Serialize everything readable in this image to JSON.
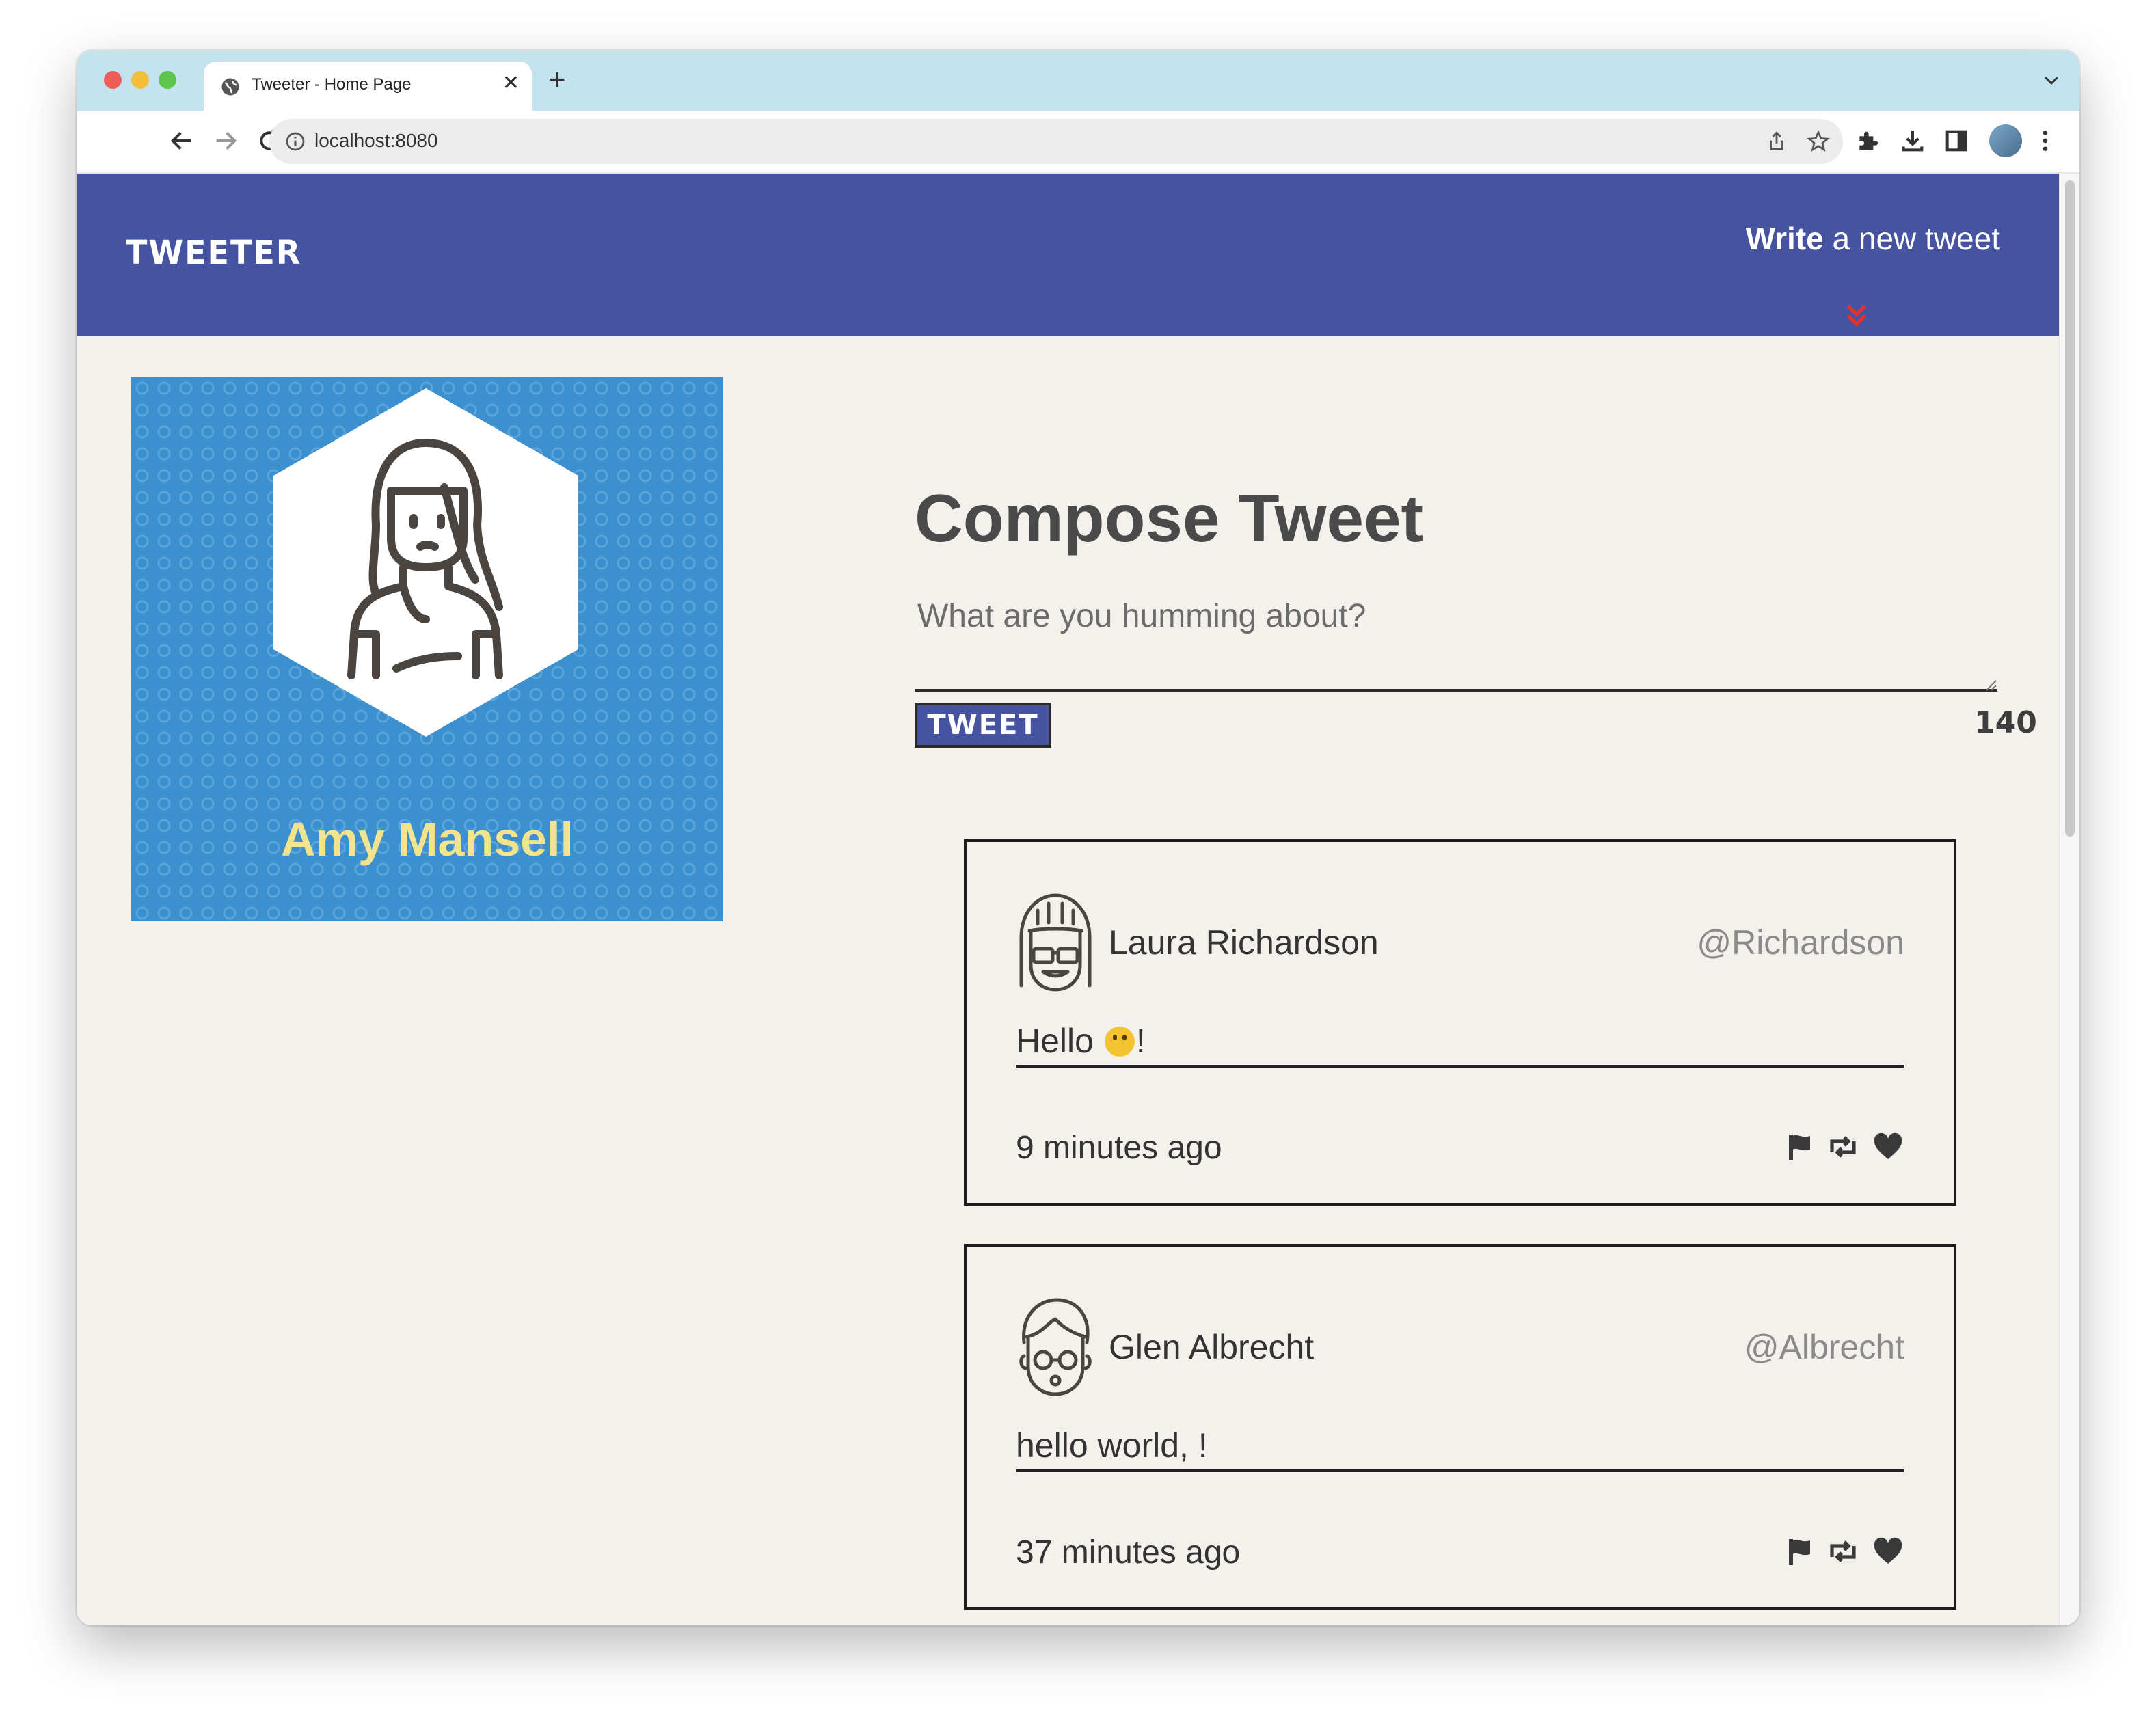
{
  "browser": {
    "tab_title": "Tweeter - Home Page",
    "url": "localhost:8080"
  },
  "app": {
    "brand": "TWEETER",
    "write_bold": "Write",
    "write_rest": " a new tweet"
  },
  "profile": {
    "name": "Amy Mansell"
  },
  "compose": {
    "title": "Compose Tweet",
    "placeholder": "What are you humming about?",
    "button": "TWEET",
    "counter": "140"
  },
  "tweets": [
    {
      "name": "Laura Richardson",
      "handle": "@Richardson",
      "content_before": "Hello ",
      "content_emoji": "grinning-face",
      "content_after": "!",
      "time": "9 minutes ago"
    },
    {
      "name": "Glen Albrecht",
      "handle": "@Albrecht",
      "content": "hello world, !",
      "time": "37 minutes ago"
    }
  ],
  "colors": {
    "nav": "#4653a0",
    "page_bg": "#f4f1ec",
    "profile_bg": "#3c90d0",
    "profile_name": "#f1e48c",
    "chevron": "#e0332e",
    "tab_strip": "#c3e4ef"
  },
  "icons": {
    "tweet_actions": [
      "flag-icon",
      "retweet-icon",
      "heart-icon"
    ]
  }
}
